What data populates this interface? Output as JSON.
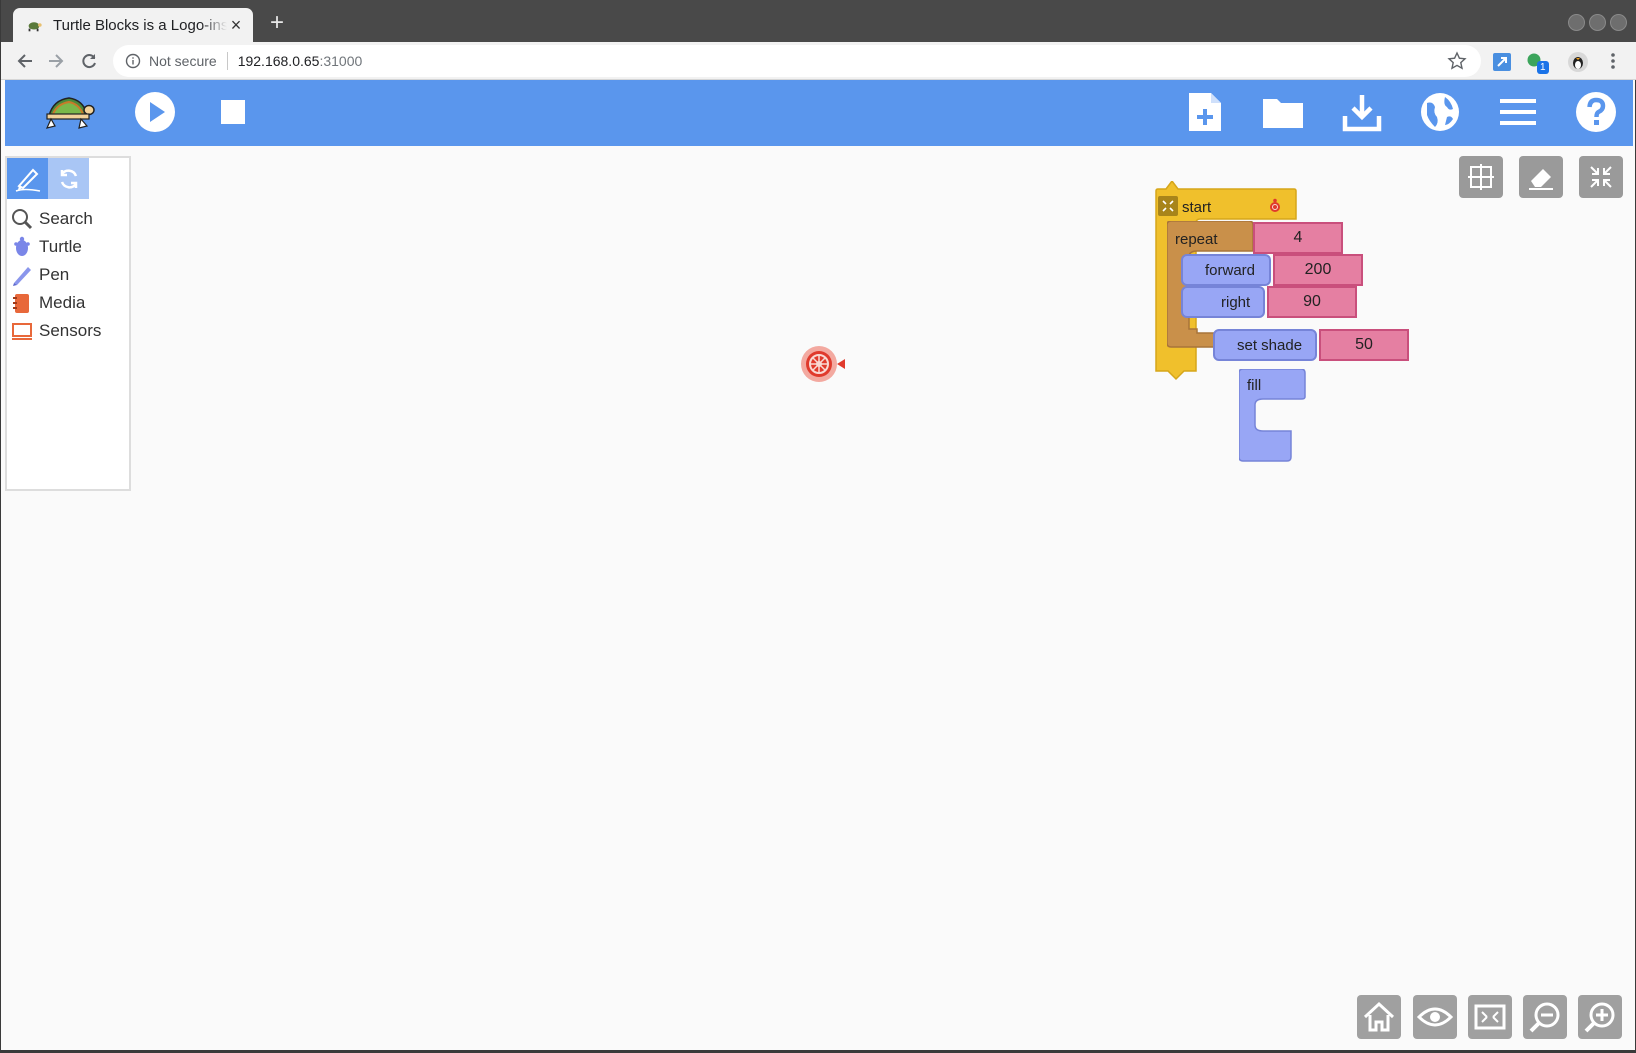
{
  "browser": {
    "tab_title": "Turtle Blocks is a Logo-inspired",
    "tab_close": "×",
    "new_tab": "+",
    "security_label": "Not secure",
    "url_host": "192.168.0.65",
    "url_port": ":31000",
    "extension_badge": "1"
  },
  "app": {
    "header_buttons": [
      "turtle-logo",
      "run",
      "stop",
      "new-project",
      "open-project",
      "save",
      "language",
      "settings-menu",
      "help"
    ],
    "accent_color": "#5a96ed"
  },
  "palette": {
    "items": [
      {
        "label": "Search",
        "icon": "search-icon"
      },
      {
        "label": "Turtle",
        "icon": "turtle-icon"
      },
      {
        "label": "Pen",
        "icon": "pen-icon"
      },
      {
        "label": "Media",
        "icon": "media-icon"
      },
      {
        "label": "Sensors",
        "icon": "sensors-icon"
      }
    ]
  },
  "blocks": {
    "start_label": "start",
    "repeat_label": "repeat",
    "repeat_count": "4",
    "forward_label": "forward",
    "forward_value": "200",
    "right_label": "right",
    "right_value": "90",
    "set_shade_label": "set shade",
    "set_shade_value": "50",
    "fill_label": "fill"
  },
  "colors": {
    "start_block": "#f0c02c",
    "repeat_block": "#c9904a",
    "pen_block": "#98a6f5",
    "number_block": "#e57fa2",
    "turtle": "#e03a2c"
  }
}
